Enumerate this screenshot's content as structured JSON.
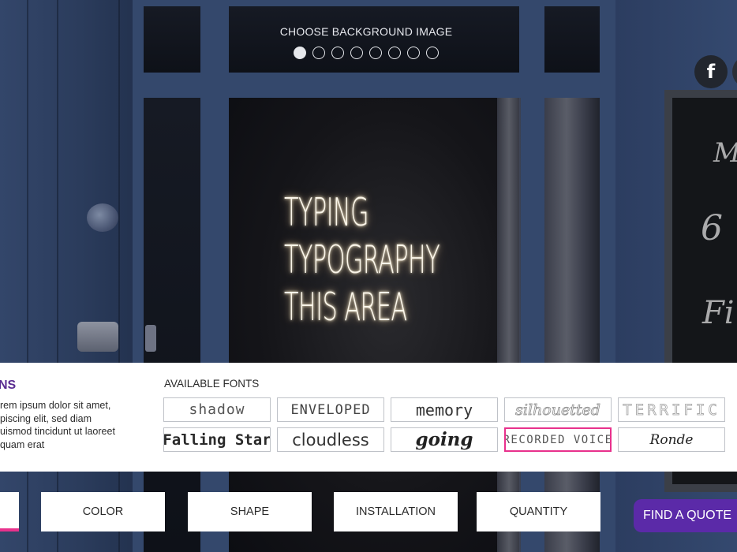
{
  "background_chooser": {
    "title": "CHOOSE BACKGROUND IMAGE",
    "options_count": 8,
    "selected_index": 0
  },
  "social": {
    "facebook_label": "f"
  },
  "preview": {
    "lines": [
      "TYPING",
      "TYPOGRAPHY",
      "THIS AREA"
    ]
  },
  "panel": {
    "heading": "NS",
    "description": "rem ipsum dolor sit amet, piscing elit, sed diam uismod tincidunt ut laoreet quam erat",
    "description_lines": [
      "rem ipsum dolor sit amet,",
      "piscing elit, sed diam",
      "uismod tincidunt ut laoreet",
      "quam erat"
    ],
    "fonts_title": "AVAILABLE FONTS",
    "fonts": [
      {
        "label": "shadow",
        "selected": false
      },
      {
        "label": "ENVELOPED",
        "selected": false
      },
      {
        "label": "memory",
        "selected": false
      },
      {
        "label": "silhouetted",
        "selected": false
      },
      {
        "label": "TERRIFIC",
        "selected": false
      },
      {
        "label": "Falling Star",
        "selected": false
      },
      {
        "label": "cloudless",
        "selected": false
      },
      {
        "label": "going",
        "selected": false
      },
      {
        "label": "RECORDED VOICE",
        "selected": true
      },
      {
        "label": "Ronde",
        "selected": false
      }
    ]
  },
  "nav": {
    "tabs": [
      "COLOR",
      "SHAPE",
      "INSTALLATION",
      "QUANTITY"
    ],
    "quote_label": "FIND A QUOTE"
  },
  "chalkboard": {
    "visible_text": [
      "M",
      "6",
      "Fi"
    ]
  },
  "colors": {
    "accent_pink": "#e8318c",
    "brand_purple": "#5b2aa8",
    "heading_purple": "#5a2d91"
  }
}
